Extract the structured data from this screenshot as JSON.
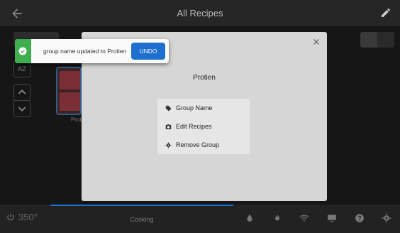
{
  "header": {
    "title": "All Recipes",
    "back_icon": "arrow-back-icon",
    "edit_icon": "pencil-icon"
  },
  "background": {
    "sort_label": "AZ",
    "thumb_label": "Prot"
  },
  "modal": {
    "title": "Protien",
    "menu": [
      {
        "label": "Group Name",
        "icon": "tag-icon"
      },
      {
        "label": "Edit Recipes",
        "icon": "camera-icon"
      },
      {
        "label": "Remove Group",
        "icon": "gear-icon"
      }
    ]
  },
  "toast": {
    "message": "group name updated to Protien",
    "action_label": "UNDO",
    "accent": "#3fae4f",
    "button_color": "#1e6fd0"
  },
  "footer": {
    "temperature": "350",
    "temperature_suffix": "°",
    "tab_label": "Cooking",
    "icons": [
      "drop-icon",
      "flame-icon",
      "wifi-icon",
      "screen-icon",
      "help-icon",
      "settings-icon"
    ]
  }
}
